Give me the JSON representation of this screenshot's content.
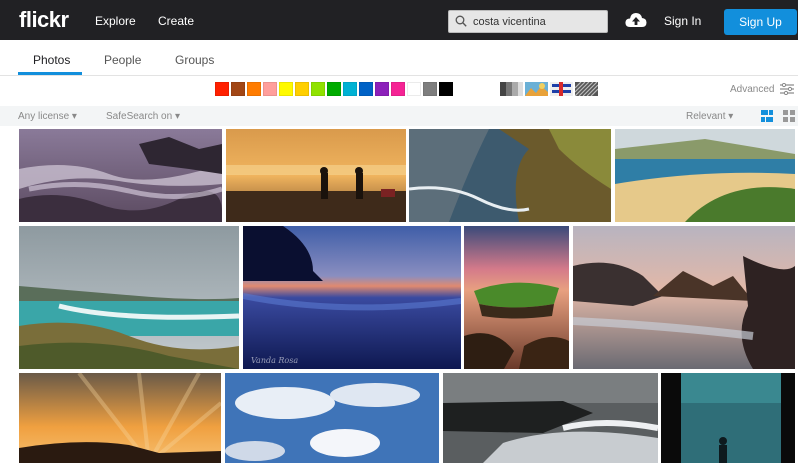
{
  "header": {
    "logo": "flickr",
    "nav": {
      "explore": "Explore",
      "create": "Create"
    },
    "search": {
      "value": "costa vicentina"
    },
    "sign_in": "Sign In",
    "sign_up": "Sign Up"
  },
  "tabs": [
    {
      "label": "Photos",
      "active": true
    },
    {
      "label": "People",
      "active": false
    },
    {
      "label": "Groups",
      "active": false
    }
  ],
  "color_filters": [
    "#ff2000",
    "#a24615",
    "#ff7c00",
    "#ff9f9c",
    "#fffa00",
    "#ffcf00",
    "#90e200",
    "#00ab00",
    "#00b2d4",
    "#0062c6",
    "#8c20ba",
    "#f52394",
    "#ffffff",
    "#7e7e7e",
    "#000000"
  ],
  "style_filters": [
    "black-and-white-icon",
    "depth-of-field-icon",
    "minimalist-icon",
    "pattern-icon"
  ],
  "advanced_label": "Advanced",
  "filterbar": {
    "license": "Any license",
    "safesearch": "SafeSearch on",
    "sort": "Relevant"
  },
  "photos": {
    "watermark": "Vanda Rosa"
  },
  "colors": {
    "topbar": "#212124",
    "accent": "#128fdc",
    "filterbar": "#f3f5f6"
  }
}
